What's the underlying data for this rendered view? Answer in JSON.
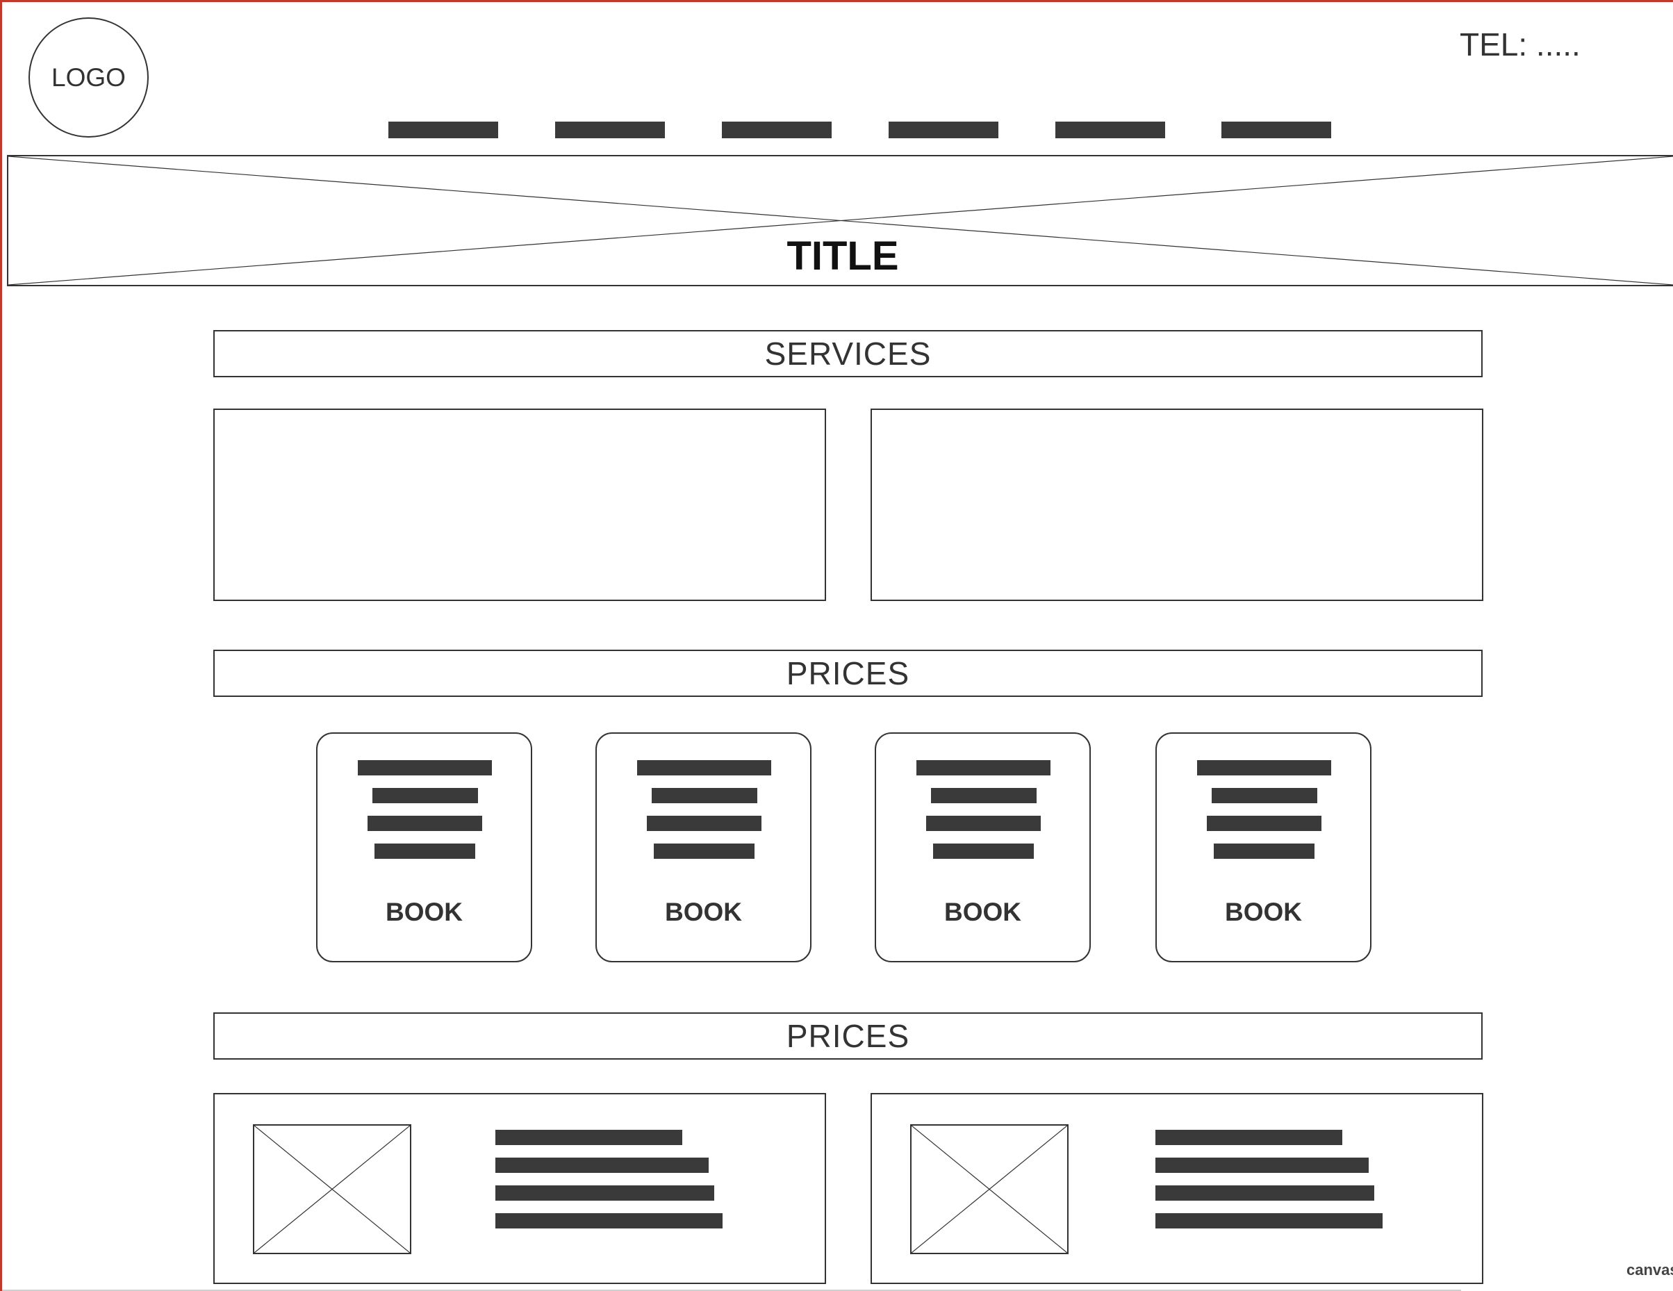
{
  "header": {
    "logo_label": "LOGO",
    "tel_label": "TEL: .....",
    "nav_items": 6
  },
  "hero": {
    "title": "TITLE"
  },
  "sections": {
    "services_label": "SERVICES",
    "prices_label_1": "PRICES",
    "prices_label_2": "PRICES"
  },
  "price_cards": [
    {
      "button_label": "BOOK"
    },
    {
      "button_label": "BOOK"
    },
    {
      "button_label": "BOOK"
    },
    {
      "button_label": "BOOK"
    }
  ],
  "footer": {
    "canvas_label": "canvas"
  },
  "colors": {
    "frame_accent": "#c0392b",
    "placeholder_bar": "#3a3a3a",
    "outline": "#333333"
  }
}
